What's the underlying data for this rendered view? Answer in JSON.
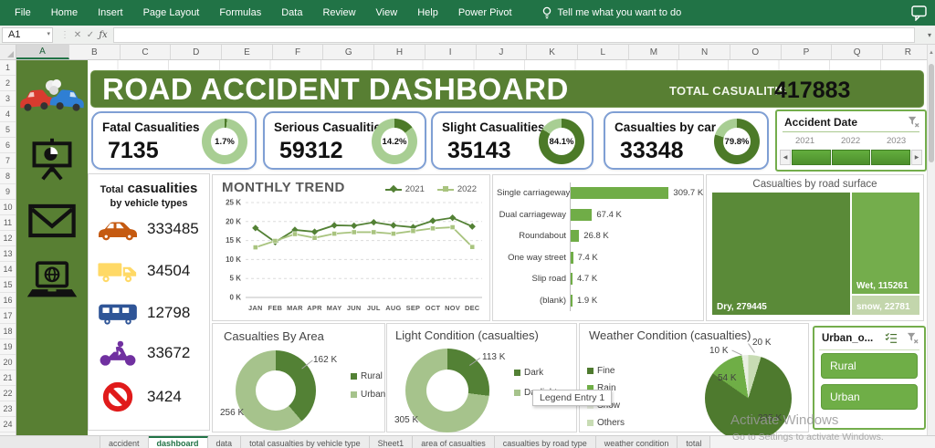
{
  "ribbon": {
    "menus": [
      "File",
      "Home",
      "Insert",
      "Page Layout",
      "Formulas",
      "Data",
      "Review",
      "View",
      "Help",
      "Power Pivot"
    ],
    "tell_me": "Tell me what you want to do"
  },
  "formula_bar": {
    "name_box": "A1",
    "formula_value": ""
  },
  "glyphs": {
    "cancel": "✕",
    "check": "✓",
    "fx": "ƒx",
    "dropdown": "▾",
    "left": "◀",
    "right": "▶",
    "up": "▲"
  },
  "grid": {
    "columns": [
      "A",
      "B",
      "C",
      "D",
      "E",
      "F",
      "G",
      "H",
      "I",
      "J",
      "K",
      "L",
      "M",
      "N",
      "O",
      "P",
      "Q",
      "R"
    ],
    "row_count": 25,
    "selected_cell": "A1"
  },
  "header": {
    "title": "ROAD ACCIDENT DASHBOARD",
    "total_label": "TOTAL CASUALITIS",
    "total_value": "417883"
  },
  "kpis": [
    {
      "label": "Fatal Casualities",
      "value": "7135",
      "pct": "1.7%",
      "pct_num": 1.7
    },
    {
      "label": "Serious Casualities",
      "value": "59312",
      "pct": "14.2%",
      "pct_num": 14.2
    },
    {
      "label": "Slight Casualities",
      "value": "35143",
      "pct": "84.1%",
      "pct_num": 84.1
    },
    {
      "label": "Casualties by car",
      "value": "33348",
      "pct": "79.8%",
      "pct_num": 79.8
    }
  ],
  "timeline": {
    "title": "Accident Date",
    "years": [
      "2021",
      "2022",
      "2023"
    ]
  },
  "vehicle_panel": {
    "title_small": "Total",
    "title_big": "casualities",
    "subtitle": "by vehicle types",
    "items": [
      {
        "icon": "car",
        "color": "#c55a11",
        "value": "333485"
      },
      {
        "icon": "truck",
        "color": "#ffd966",
        "value": "34504"
      },
      {
        "icon": "bus",
        "color": "#2f5597",
        "value": "12798"
      },
      {
        "icon": "motorcycle",
        "color": "#7030a0",
        "value": "33672"
      },
      {
        "icon": "no-entry",
        "color": "#e01b1b",
        "value": "3424"
      }
    ]
  },
  "chart_data": [
    {
      "name": "monthly-trend",
      "type": "line",
      "title": "MONTHLY TREND",
      "categories": [
        "JAN",
        "FEB",
        "MAR",
        "APR",
        "MAY",
        "JUN",
        "JUL",
        "AUG",
        "SEP",
        "OCT",
        "NOV",
        "DEC"
      ],
      "series": [
        {
          "name": "2021",
          "color": "#538135",
          "marker": "diamond",
          "values": [
            18.3,
            14.6,
            17.8,
            17.3,
            19.0,
            18.9,
            19.8,
            19.0,
            18.5,
            20.2,
            21.0,
            18.7
          ]
        },
        {
          "name": "2022",
          "color": "#a9c47f",
          "marker": "square",
          "values": [
            13.2,
            14.9,
            16.7,
            15.7,
            16.8,
            17.2,
            17.2,
            16.8,
            17.5,
            18.2,
            18.5,
            13.3
          ]
        }
      ],
      "ylim": [
        0,
        25
      ],
      "yticks": [
        0,
        5,
        10,
        15,
        20,
        25
      ],
      "ytick_labels": [
        "0 K",
        "5 K",
        "10 K",
        "15 K",
        "20 K",
        "25 K"
      ],
      "grid": true,
      "legend_position": "top-right"
    },
    {
      "name": "casualties-by-road-type",
      "type": "bar",
      "orientation": "horizontal",
      "categories": [
        "Single carriageway",
        "Dual carriageway",
        "Roundabout",
        "One way street",
        "Slip road",
        "(blank)"
      ],
      "values": [
        309.7,
        67.4,
        26.8,
        7.4,
        4.7,
        1.9
      ],
      "value_labels": [
        "309.7 K",
        "67.4 K",
        "26.8 K",
        "7.4 K",
        "4.7 K",
        "1.9 K"
      ],
      "bar_color": "#70ad47",
      "xmax": 320
    },
    {
      "name": "casualties-by-road-surface",
      "type": "treemap",
      "title": "Casualties by road surface",
      "items": [
        {
          "label": "Dry, 279445",
          "value": 279445,
          "color": "#5a8a38"
        },
        {
          "label": "Wet, 115261",
          "value": 115261,
          "color": "#74ad4c"
        },
        {
          "label": "snow, 22781",
          "value": 22781,
          "color": "#c3d6ac"
        }
      ]
    },
    {
      "name": "casualties-by-area",
      "type": "donut",
      "title": "Casualties By Area",
      "slices": [
        {
          "label": "Rural",
          "value": 162,
          "display": "162 K",
          "color": "#538135"
        },
        {
          "label": "Urban",
          "value": 256,
          "display": "256 K",
          "color": "#a6c38c"
        }
      ]
    },
    {
      "name": "light-condition",
      "type": "donut",
      "title": "Light Condition (casualties)",
      "slices": [
        {
          "label": "Dark",
          "value": 113,
          "display": "113 K",
          "color": "#538135"
        },
        {
          "label": "Daylight",
          "value": 305,
          "display": "305 K",
          "color": "#a6c38c"
        }
      ]
    },
    {
      "name": "weather-condition",
      "type": "pie",
      "title": "Weather Condition (casualties)",
      "slices": [
        {
          "label": "Fine",
          "value": 335,
          "display": "335 K",
          "color": "#4e7a2e"
        },
        {
          "label": "Rain",
          "value": 54,
          "display": "54 K",
          "color": "#6fae46"
        },
        {
          "label": "Snow",
          "value": 10,
          "display": "10 K",
          "color": "#e9efe2"
        },
        {
          "label": "Others",
          "value": 20,
          "display": "20 K",
          "color": "#c8dcb4"
        }
      ],
      "draw_order": [
        3,
        0,
        1,
        2
      ]
    }
  ],
  "urban_slicer": {
    "title": "Urban_o...",
    "items": [
      "Rural",
      "Urban"
    ]
  },
  "tooltip_text": "Legend Entry 1",
  "watermark": {
    "line1": "Activate Windows",
    "line2": "Go to Settings to activate Windows."
  },
  "sheet_tabs": [
    "accident",
    "dashboard",
    "data",
    "total casualties by vehicle type",
    "Sheet1",
    "area of casualties",
    "casualties by road type",
    "weather condition",
    "total"
  ],
  "active_tab": "dashboard",
  "colors": {
    "excel_green": "#217346",
    "dashboard_green": "#587f33",
    "kpi_dark": "#4c7a28",
    "kpi_light": "#a8ce93"
  }
}
